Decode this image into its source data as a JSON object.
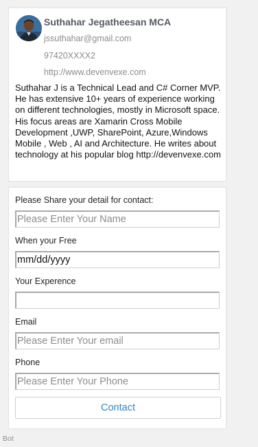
{
  "profile": {
    "name": "Suthahar Jegatheesan MCA",
    "email": "jssuthahar@gmail.com",
    "phone": "97420XXXX2",
    "url": "http://www.devenvexe.com",
    "bio": "Suthahar J is a Technical Lead and C# Corner MVP. He has extensive 10+ years of experience working on different technologies, mostly in Microsoft space. His focus areas are Xamarin Cross Mobile Development ,UWP, SharePoint, Azure,Windows Mobile , Web , AI and Architecture. He writes about technology at his popular blog http://devenvexe.com"
  },
  "form": {
    "heading": "Please Share your detail for contact:",
    "name_placeholder": "Please Enter Your Name",
    "when_label": "When your Free",
    "date_value": "mm/dd/yyyy",
    "experience_label": "Your Experence",
    "experience_value": "",
    "email_label": "Email",
    "email_placeholder": "Please Enter Your email",
    "phone_label": "Phone",
    "phone_placeholder": "Please Enter Your Phone",
    "contact_button": "Contact"
  },
  "sender": "Bot",
  "colors": {
    "button_text": "#2f86c8",
    "page_background": "#f1f1f1"
  }
}
